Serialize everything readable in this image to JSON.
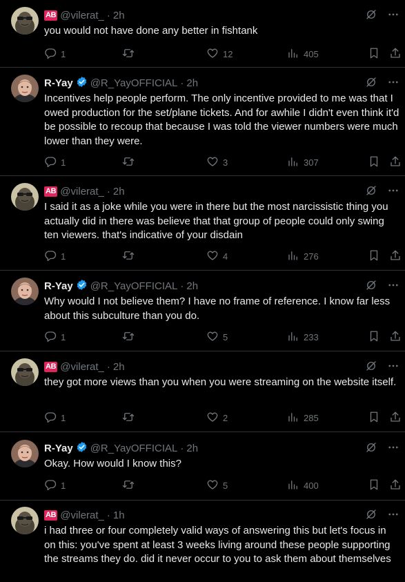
{
  "tweets": [
    {
      "kind": "vilerat",
      "badge": "AB",
      "name": "",
      "handle": "@vilerat_",
      "dot": "·",
      "time": "2h",
      "text": "you would not have done any better in fishtank",
      "replies": "1",
      "retweets": "",
      "likes": "12",
      "views": "405"
    },
    {
      "kind": "ryay",
      "badge": "",
      "name": "R-Yay",
      "handle": "@R_YayOFFICIAL",
      "dot": "·",
      "time": "2h",
      "text": "Incentives help people perform. The only incentive provided to me was that I owed production for the set/plane tickets. And for awhile I didn't even think it'd be possible to recoup that because I was told the viewer numbers were much lower than they were.",
      "replies": "1",
      "retweets": "",
      "likes": "3",
      "views": "307"
    },
    {
      "kind": "vilerat",
      "badge": "AB",
      "name": "",
      "handle": "@vilerat_",
      "dot": "·",
      "time": "2h",
      "text": "I said it as a joke while you were in there but the most narcissistic thing you actually did in there was believe that that group of people could only swing ten viewers. that's indicative of your disdain",
      "replies": "1",
      "retweets": "",
      "likes": "4",
      "views": "276"
    },
    {
      "kind": "ryay",
      "badge": "",
      "name": "R-Yay",
      "handle": "@R_YayOFFICIAL",
      "dot": "·",
      "time": "2h",
      "text": "Why would I not believe them? I have no frame of reference. I know far less about this subculture than you do.",
      "replies": "1",
      "retweets": "",
      "likes": "5",
      "views": "233"
    },
    {
      "kind": "vilerat",
      "badge": "AB",
      "name": "",
      "handle": "@vilerat_",
      "dot": "·",
      "time": "2h",
      "text": "they got more views than you when you were streaming on the website itself.",
      "replies": "1",
      "retweets": "",
      "likes": "2",
      "views": "285"
    },
    {
      "kind": "ryay",
      "badge": "",
      "name": "R-Yay",
      "handle": "@R_YayOFFICIAL",
      "dot": "·",
      "time": "2h",
      "text": "Okay. How would I know this?",
      "replies": "1",
      "retweets": "",
      "likes": "5",
      "views": "400"
    },
    {
      "kind": "vilerat",
      "badge": "AB",
      "name": "",
      "handle": "@vilerat_",
      "dot": "·",
      "time": "1h",
      "text": "i had three or four completely valid ways of answering this but let's focus in on this: you've spent at least 3 weeks living around these people supporting the streams they do. did it never occur to you to ask them about themselves",
      "replies": "",
      "retweets": "",
      "likes": "",
      "views": ""
    }
  ],
  "colors": {
    "background": "#000000",
    "text": "#e7e9ea",
    "muted": "#71767b",
    "verified": "#1d9bf0",
    "ab_badge": "#e0245e"
  },
  "icons": {
    "grok": "grok-icon",
    "more": "more-icon",
    "reply": "reply-icon",
    "retweet": "retweet-icon",
    "like": "like-icon",
    "views": "views-icon",
    "bookmark": "bookmark-icon",
    "share": "share-icon"
  }
}
